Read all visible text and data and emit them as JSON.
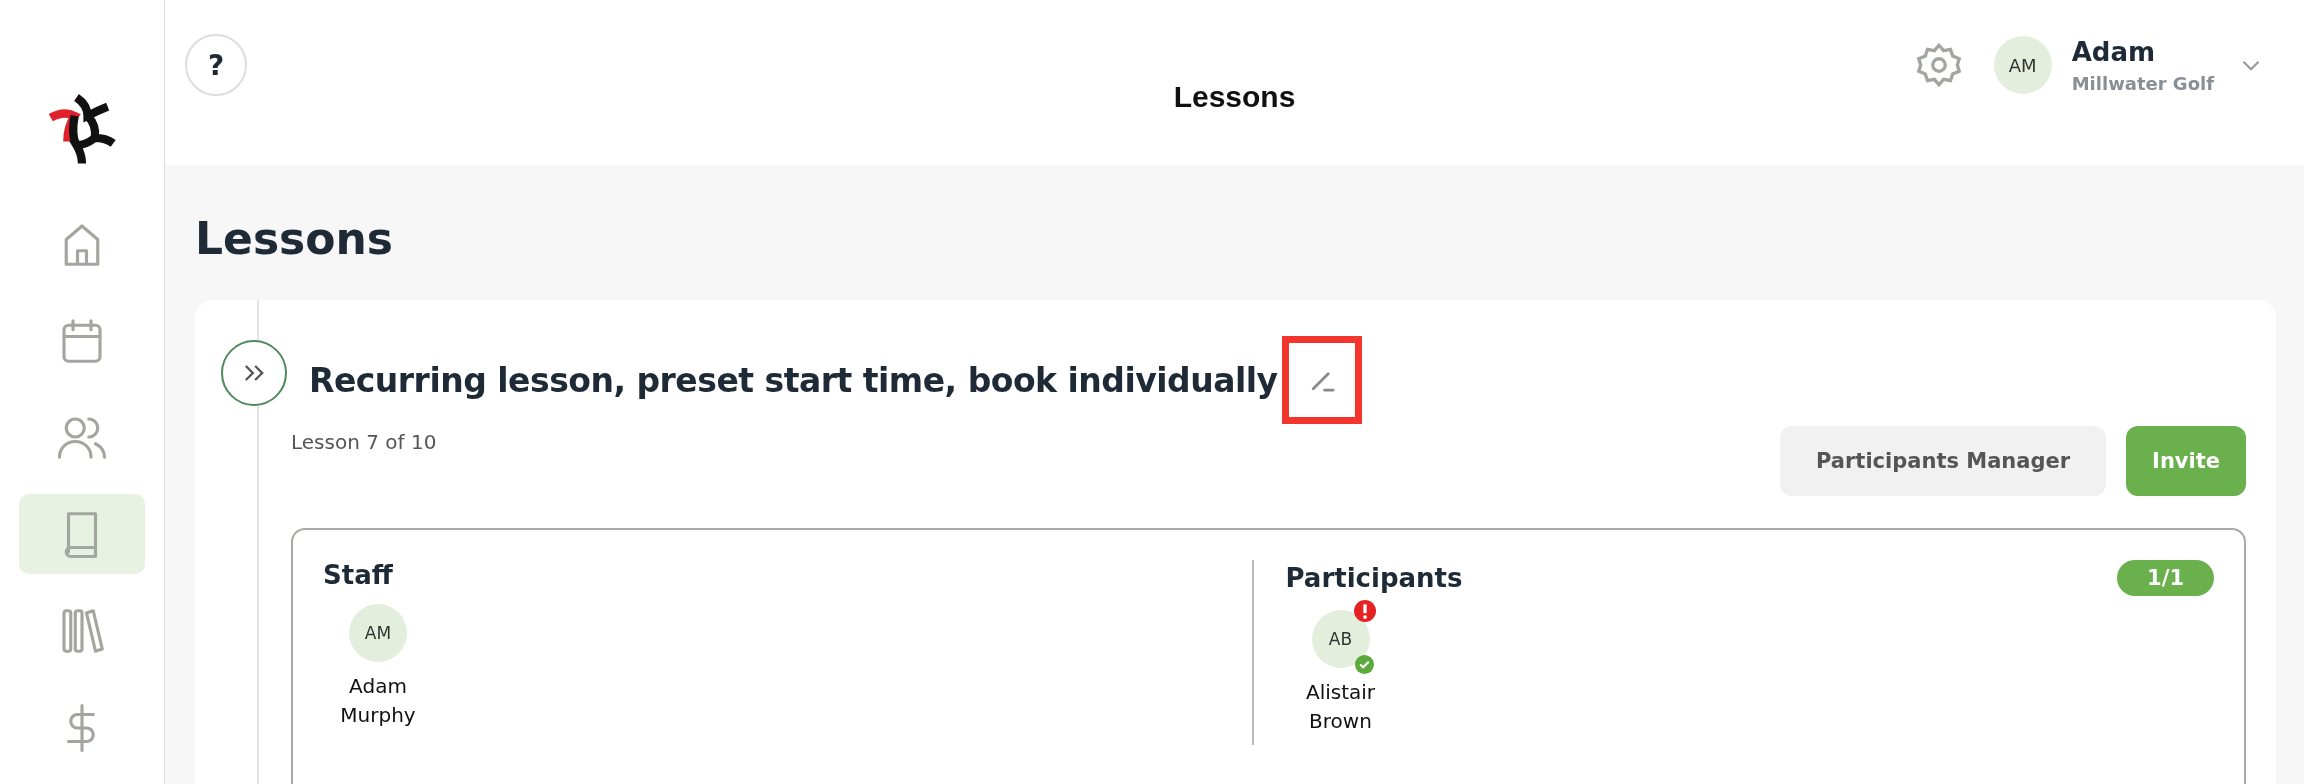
{
  "sidebar": {
    "items": [
      {
        "selected": false
      },
      {
        "selected": false
      },
      {
        "selected": false
      },
      {
        "selected": true
      },
      {
        "selected": false
      },
      {
        "selected": false
      }
    ]
  },
  "header": {
    "help": "?",
    "title": "Lessons",
    "user": {
      "initials": "AM",
      "name": "Adam",
      "organization": "Millwater Golf"
    }
  },
  "page_title": "Lessons",
  "lesson": {
    "title": "Recurring lesson, preset start time, book individually",
    "edit_highlighted": true,
    "subtitle": "Lesson 7 of 10",
    "buttons": [
      {
        "label": "Participants Manager",
        "kind": "secondary"
      },
      {
        "label": "Invite",
        "kind": "primary"
      }
    ],
    "sections": [
      {
        "title": "Staff",
        "people": [
          {
            "initials": "AM",
            "name": "Adam Murphy",
            "alert": false,
            "confirmed": false
          }
        ]
      },
      {
        "title": "Participants",
        "count": "1/1",
        "people": [
          {
            "initials": "AB",
            "name": "Alistair Brown",
            "alert": true,
            "confirmed": true
          }
        ]
      }
    ]
  }
}
